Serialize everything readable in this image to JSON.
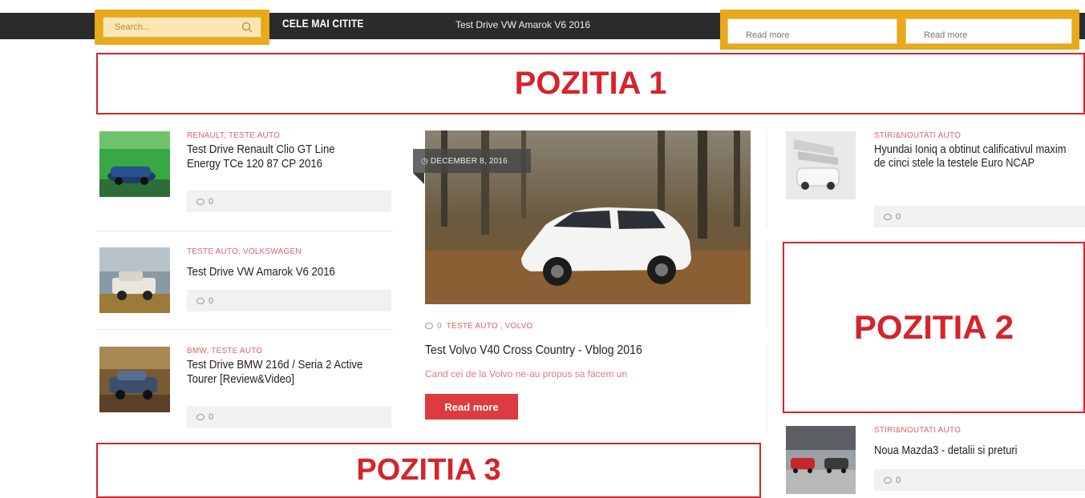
{
  "topbar": {
    "search_placeholder": "Search...",
    "popular_title": "CELE MAI CITITE",
    "ticker": "Test Drive VW Amarok V6 2016",
    "read_more_1": "Read more",
    "read_more_2": "Read more"
  },
  "ads": {
    "pos1": "POZITIA 1",
    "pos2": "POZITIA 2",
    "pos3": "POZITIA 3"
  },
  "left_posts": [
    {
      "category": "RENAULT, TESTE AUTO",
      "title": "Test Drive Renault Clio GT Line Energy TCe 120 87 CP 2016",
      "comments": "0"
    },
    {
      "category": "TESTE AUTO, VOLKSWAGEN",
      "title": "Test Drive VW Amarok V6 2016",
      "comments": "0"
    },
    {
      "category": "BMW, TESTE AUTO",
      "title": "Test Drive BMW 216d / Seria 2 Active Tourer [Review&Video]",
      "comments": "0"
    }
  ],
  "featured": {
    "date": "DECEMBER 8, 2016",
    "comments": "0",
    "categories": "TESTE AUTO   , VOLVO",
    "title": "Test Volvo V40 Cross Country - Vblog 2016",
    "excerpt": "Cand cei de la Volvo ne-au propus sa facem un",
    "button": "Read more"
  },
  "right_posts": [
    {
      "category": "STIRI&NOUTATI AUTO",
      "title": "Hyundai Ioniq a obtinut calificativul maxim de cinci stele la testele Euro NCAP",
      "comments": "0"
    },
    {
      "category": "STIRI&NOUTATI AUTO",
      "title": "Noua Mazda3 - detalii si preturi",
      "comments": "0"
    }
  ],
  "colors": {
    "accent_red": "#d5242c",
    "gold": "#e8a91a",
    "topbar": "#2b2b2b"
  }
}
